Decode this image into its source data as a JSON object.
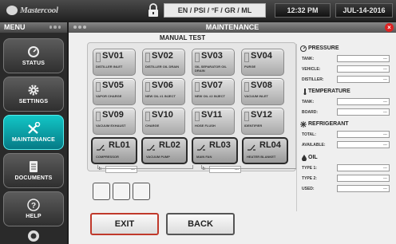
{
  "brand": {
    "name": "Mastercool"
  },
  "status_bar": {
    "units": "EN / PSI / °F / GR / ML",
    "time": "12:32 PM",
    "date": "JUL-14-2016"
  },
  "menu": {
    "title": "MENU",
    "items": [
      {
        "label": "STATUS",
        "icon": "gauge-icon"
      },
      {
        "label": "SETTINGS",
        "icon": "gear-icon"
      },
      {
        "label": "MAINTENANCE",
        "icon": "tools-icon",
        "active": true
      },
      {
        "label": "DOCUMENTS",
        "icon": "document-icon"
      },
      {
        "label": "HELP",
        "icon": "help-icon"
      }
    ]
  },
  "panel": {
    "title": "MAINTENANCE",
    "subtitle": "MANUAL TEST"
  },
  "valves": [
    {
      "id": "SV01",
      "desc": "DISTILLER INLET"
    },
    {
      "id": "SV02",
      "desc": "DISTILLER OIL DRAIN"
    },
    {
      "id": "SV03",
      "desc": "OIL SEPARATOR OIL DRAIN"
    },
    {
      "id": "SV04",
      "desc": "PURGE"
    },
    {
      "id": "SV05",
      "desc": "VAPOR CHARGE"
    },
    {
      "id": "SV06",
      "desc": "NEW OIL #1 INJECT"
    },
    {
      "id": "SV07",
      "desc": "NEW OIL #2 INJECT"
    },
    {
      "id": "SV08",
      "desc": "VACUUM INLET"
    },
    {
      "id": "SV09",
      "desc": "VACUUM EXHAUST"
    },
    {
      "id": "SV10",
      "desc": "CHARGE"
    },
    {
      "id": "SV11",
      "desc": "HOSE FLUSH"
    },
    {
      "id": "SV12",
      "desc": "IDENTIFIER"
    }
  ],
  "relays": [
    {
      "id": "RL01",
      "desc": "COMPRESSOR"
    },
    {
      "id": "RL02",
      "desc": "VACUUM PUMP"
    },
    {
      "id": "RL03",
      "desc": "MAIN FAN"
    },
    {
      "id": "RL04",
      "desc": "HEATER BLANKET"
    }
  ],
  "relay_readouts": {
    "label": "I:",
    "value": "---"
  },
  "sensors": {
    "pressure": {
      "title": "PRESSURE",
      "rows": [
        {
          "label": "TANK:",
          "value": "---"
        },
        {
          "label": "VEHICLE:",
          "value": "---"
        },
        {
          "label": "DISTILLER:",
          "value": "---"
        }
      ]
    },
    "temperature": {
      "title": "TEMPERATURE",
      "rows": [
        {
          "label": "TANK:",
          "value": "---"
        },
        {
          "label": "BOARD:",
          "value": "---"
        }
      ]
    },
    "refrigerant": {
      "title": "REFRIGERANT",
      "rows": [
        {
          "label": "TOTAL:",
          "value": "---"
        },
        {
          "label": "AVAILABLE:",
          "value": "---"
        }
      ]
    },
    "oil": {
      "title": "OIL",
      "rows": [
        {
          "label": "TYPE 1:",
          "value": "---"
        },
        {
          "label": "TYPE 2:",
          "value": "---"
        },
        {
          "label": "USED:",
          "value": "---"
        }
      ]
    }
  },
  "buttons": {
    "exit": "EXIT",
    "back": "BACK"
  }
}
